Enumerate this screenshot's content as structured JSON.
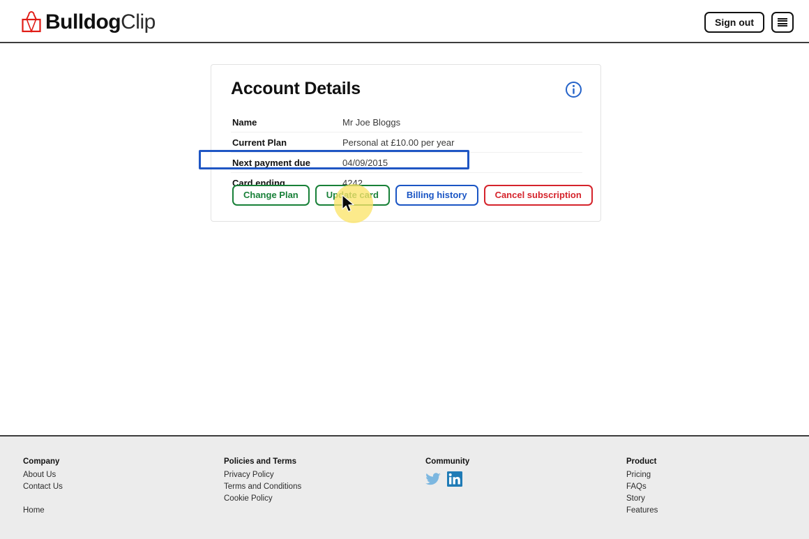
{
  "header": {
    "logo": {
      "icon": "bulldog-clip-icon",
      "bold_text": "Bulldog",
      "light_text": "Clip",
      "icon_color": "#e01b15"
    },
    "sign_out_label": "Sign out",
    "menu_icon": "hamburger-menu-icon"
  },
  "card": {
    "title": "Account Details",
    "info_icon": "info-circle-icon",
    "info_icon_color": "#2563c9",
    "rows": [
      {
        "label": "Name",
        "value": "Mr Joe Bloggs"
      },
      {
        "label": "Current Plan",
        "value": "Personal at £10.00 per year"
      },
      {
        "label": "Next payment due",
        "value": "04/09/2015"
      },
      {
        "label": "Card ending",
        "value": "4242"
      }
    ],
    "buttons": [
      {
        "label": "Change Plan",
        "color": "#188038"
      },
      {
        "label": "Update card",
        "color": "#188038"
      },
      {
        "label": "Billing history",
        "color": "#1a55c4"
      },
      {
        "label": "Cancel subscription",
        "color": "#d5232b"
      }
    ]
  },
  "annotation": {
    "highlight_color": "#1f56c4",
    "highlight_target": "Card ending",
    "cursor_halo_color": "#fbe46a",
    "cursor_target": "Update card"
  },
  "footer": {
    "columns": [
      {
        "heading": "Company",
        "links": [
          "About Us",
          "Contact Us"
        ],
        "extra_links": [
          "Home"
        ]
      },
      {
        "heading": "Policies and Terms",
        "links": [
          "Privacy Policy",
          "Terms and Conditions",
          "Cookie Policy"
        ]
      },
      {
        "heading": "Community",
        "social": [
          {
            "name": "twitter-icon",
            "color": "#7cb7e0"
          },
          {
            "name": "linkedin-icon",
            "color": "#1f7bb6"
          }
        ]
      },
      {
        "heading": "Product",
        "links": [
          "Pricing",
          "FAQs",
          "Story",
          "Features"
        ]
      }
    ]
  }
}
